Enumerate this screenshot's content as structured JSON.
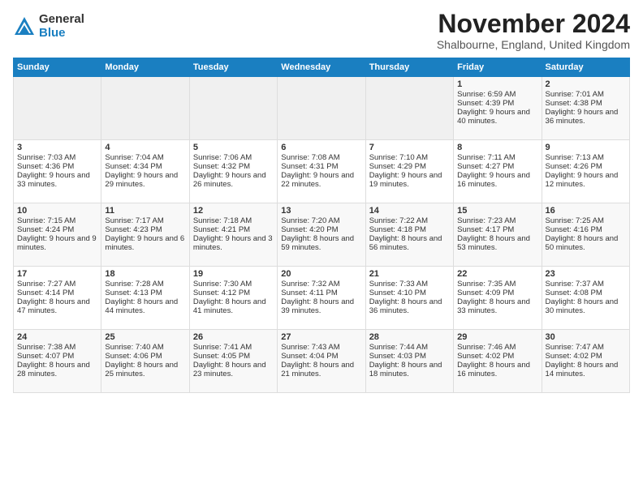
{
  "header": {
    "logo_general": "General",
    "logo_blue": "Blue",
    "month_title": "November 2024",
    "location": "Shalbourne, England, United Kingdom"
  },
  "weekdays": [
    "Sunday",
    "Monday",
    "Tuesday",
    "Wednesday",
    "Thursday",
    "Friday",
    "Saturday"
  ],
  "weeks": [
    [
      {
        "day": "",
        "empty": true
      },
      {
        "day": "",
        "empty": true
      },
      {
        "day": "",
        "empty": true
      },
      {
        "day": "",
        "empty": true
      },
      {
        "day": "",
        "empty": true
      },
      {
        "day": "1",
        "sunrise": "Sunrise: 6:59 AM",
        "sunset": "Sunset: 4:39 PM",
        "daylight": "Daylight: 9 hours and 40 minutes."
      },
      {
        "day": "2",
        "sunrise": "Sunrise: 7:01 AM",
        "sunset": "Sunset: 4:38 PM",
        "daylight": "Daylight: 9 hours and 36 minutes."
      }
    ],
    [
      {
        "day": "3",
        "sunrise": "Sunrise: 7:03 AM",
        "sunset": "Sunset: 4:36 PM",
        "daylight": "Daylight: 9 hours and 33 minutes."
      },
      {
        "day": "4",
        "sunrise": "Sunrise: 7:04 AM",
        "sunset": "Sunset: 4:34 PM",
        "daylight": "Daylight: 9 hours and 29 minutes."
      },
      {
        "day": "5",
        "sunrise": "Sunrise: 7:06 AM",
        "sunset": "Sunset: 4:32 PM",
        "daylight": "Daylight: 9 hours and 26 minutes."
      },
      {
        "day": "6",
        "sunrise": "Sunrise: 7:08 AM",
        "sunset": "Sunset: 4:31 PM",
        "daylight": "Daylight: 9 hours and 22 minutes."
      },
      {
        "day": "7",
        "sunrise": "Sunrise: 7:10 AM",
        "sunset": "Sunset: 4:29 PM",
        "daylight": "Daylight: 9 hours and 19 minutes."
      },
      {
        "day": "8",
        "sunrise": "Sunrise: 7:11 AM",
        "sunset": "Sunset: 4:27 PM",
        "daylight": "Daylight: 9 hours and 16 minutes."
      },
      {
        "day": "9",
        "sunrise": "Sunrise: 7:13 AM",
        "sunset": "Sunset: 4:26 PM",
        "daylight": "Daylight: 9 hours and 12 minutes."
      }
    ],
    [
      {
        "day": "10",
        "sunrise": "Sunrise: 7:15 AM",
        "sunset": "Sunset: 4:24 PM",
        "daylight": "Daylight: 9 hours and 9 minutes."
      },
      {
        "day": "11",
        "sunrise": "Sunrise: 7:17 AM",
        "sunset": "Sunset: 4:23 PM",
        "daylight": "Daylight: 9 hours and 6 minutes."
      },
      {
        "day": "12",
        "sunrise": "Sunrise: 7:18 AM",
        "sunset": "Sunset: 4:21 PM",
        "daylight": "Daylight: 9 hours and 3 minutes."
      },
      {
        "day": "13",
        "sunrise": "Sunrise: 7:20 AM",
        "sunset": "Sunset: 4:20 PM",
        "daylight": "Daylight: 8 hours and 59 minutes."
      },
      {
        "day": "14",
        "sunrise": "Sunrise: 7:22 AM",
        "sunset": "Sunset: 4:18 PM",
        "daylight": "Daylight: 8 hours and 56 minutes."
      },
      {
        "day": "15",
        "sunrise": "Sunrise: 7:23 AM",
        "sunset": "Sunset: 4:17 PM",
        "daylight": "Daylight: 8 hours and 53 minutes."
      },
      {
        "day": "16",
        "sunrise": "Sunrise: 7:25 AM",
        "sunset": "Sunset: 4:16 PM",
        "daylight": "Daylight: 8 hours and 50 minutes."
      }
    ],
    [
      {
        "day": "17",
        "sunrise": "Sunrise: 7:27 AM",
        "sunset": "Sunset: 4:14 PM",
        "daylight": "Daylight: 8 hours and 47 minutes."
      },
      {
        "day": "18",
        "sunrise": "Sunrise: 7:28 AM",
        "sunset": "Sunset: 4:13 PM",
        "daylight": "Daylight: 8 hours and 44 minutes."
      },
      {
        "day": "19",
        "sunrise": "Sunrise: 7:30 AM",
        "sunset": "Sunset: 4:12 PM",
        "daylight": "Daylight: 8 hours and 41 minutes."
      },
      {
        "day": "20",
        "sunrise": "Sunrise: 7:32 AM",
        "sunset": "Sunset: 4:11 PM",
        "daylight": "Daylight: 8 hours and 39 minutes."
      },
      {
        "day": "21",
        "sunrise": "Sunrise: 7:33 AM",
        "sunset": "Sunset: 4:10 PM",
        "daylight": "Daylight: 8 hours and 36 minutes."
      },
      {
        "day": "22",
        "sunrise": "Sunrise: 7:35 AM",
        "sunset": "Sunset: 4:09 PM",
        "daylight": "Daylight: 8 hours and 33 minutes."
      },
      {
        "day": "23",
        "sunrise": "Sunrise: 7:37 AM",
        "sunset": "Sunset: 4:08 PM",
        "daylight": "Daylight: 8 hours and 30 minutes."
      }
    ],
    [
      {
        "day": "24",
        "sunrise": "Sunrise: 7:38 AM",
        "sunset": "Sunset: 4:07 PM",
        "daylight": "Daylight: 8 hours and 28 minutes."
      },
      {
        "day": "25",
        "sunrise": "Sunrise: 7:40 AM",
        "sunset": "Sunset: 4:06 PM",
        "daylight": "Daylight: 8 hours and 25 minutes."
      },
      {
        "day": "26",
        "sunrise": "Sunrise: 7:41 AM",
        "sunset": "Sunset: 4:05 PM",
        "daylight": "Daylight: 8 hours and 23 minutes."
      },
      {
        "day": "27",
        "sunrise": "Sunrise: 7:43 AM",
        "sunset": "Sunset: 4:04 PM",
        "daylight": "Daylight: 8 hours and 21 minutes."
      },
      {
        "day": "28",
        "sunrise": "Sunrise: 7:44 AM",
        "sunset": "Sunset: 4:03 PM",
        "daylight": "Daylight: 8 hours and 18 minutes."
      },
      {
        "day": "29",
        "sunrise": "Sunrise: 7:46 AM",
        "sunset": "Sunset: 4:02 PM",
        "daylight": "Daylight: 8 hours and 16 minutes."
      },
      {
        "day": "30",
        "sunrise": "Sunrise: 7:47 AM",
        "sunset": "Sunset: 4:02 PM",
        "daylight": "Daylight: 8 hours and 14 minutes."
      }
    ]
  ]
}
